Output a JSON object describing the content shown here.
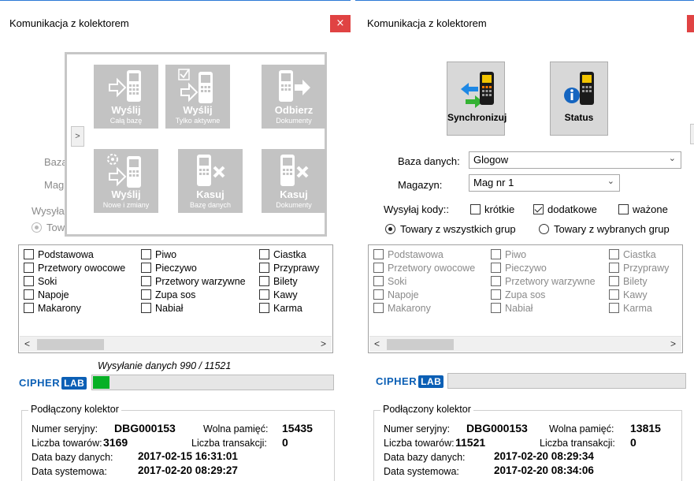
{
  "title": "Komunikacja z kolektorem",
  "close_glyph": "×",
  "left": {
    "labels": {
      "baza": "Baza",
      "mag": "Mag",
      "wysylaj": "Wysyła",
      "tow": "Tow"
    },
    "popup": {
      "expand_glyph": ">",
      "tiles": [
        {
          "title": "Wyślij",
          "subtitle": "Całą bazę"
        },
        {
          "title": "Wyślij",
          "subtitle": "Tylko aktywne"
        },
        {
          "title": "Odbierz",
          "subtitle": "Dokumenty"
        },
        {
          "title": "Wyślij",
          "subtitle": "Nowe i zmiany"
        },
        {
          "title": "Kasuj",
          "subtitle": "Bazę danych"
        },
        {
          "title": "Kasuj",
          "subtitle": "Dokumenty"
        }
      ]
    },
    "status_text": "Wysyłanie danych 990 / 11521",
    "progress_fraction": 0.07,
    "collector": {
      "legend": "Podłączony kolektor",
      "serial_label": "Numer seryjny:",
      "serial_value": "DBG000153",
      "memory_label": "Wolna pamięć:",
      "memory_value": "15435",
      "goods_label": "Liczba towarów:",
      "goods_value": "3169",
      "trans_label": "Liczba transakcji:",
      "trans_value": "0",
      "dbdate_label": "Data bazy danych:",
      "dbdate_value": "2017-02-15 16:31:01",
      "sysdate_label": "Data systemowa:",
      "sysdate_value": "2017-02-20 08:29:27"
    }
  },
  "right": {
    "sync_label": "Synchronizuj",
    "status_label": "Status",
    "db_label": "Baza danych:",
    "db_value": "Glogow",
    "mag_label": "Magazyn:",
    "mag_value": "Mag nr 1",
    "send_codes_label": "Wysyłaj kody::",
    "codes": {
      "short": "krótkie",
      "extra": "dodatkowe",
      "weighed": "ważone"
    },
    "radio_all": "Towary z wszystkich grup",
    "radio_selected": "Towary z wybranych grup",
    "progress_fraction": 0,
    "collector": {
      "legend": "Podłączony kolektor",
      "serial_label": "Numer seryjny:",
      "serial_value": "DBG000153",
      "memory_label": "Wolna pamięć:",
      "memory_value": "13815",
      "goods_label": "Liczba towarów:",
      "goods_value": "11521",
      "trans_label": "Liczba transakcji:",
      "trans_value": "0",
      "dbdate_label": "Data bazy danych:",
      "dbdate_value": "2017-02-20 08:29:34",
      "sysdate_label": "Data systemowa:",
      "sysdate_value": "2017-02-20 08:34:06"
    }
  },
  "logo": {
    "cipher": "CIPHER",
    "lab": "LAB"
  },
  "groups": {
    "col1": [
      "Podstawowa",
      "Przetwory owocowe",
      "Soki",
      "Napoje",
      "Makarony"
    ],
    "col2": [
      "Piwo",
      "Pieczywo",
      "Przetwory warzywne",
      "Zupa sos",
      "Nabiał"
    ],
    "col3": [
      "Ciastka",
      "Przyprawy",
      "Bilety",
      "Kawy",
      "Karma"
    ]
  },
  "scroll": {
    "left_glyph": "<",
    "right_glyph": ">"
  },
  "colors": {
    "accent": "#2b79d6",
    "close": "#e04343",
    "progress": "#06b025",
    "tile": "#c3c3c3"
  }
}
